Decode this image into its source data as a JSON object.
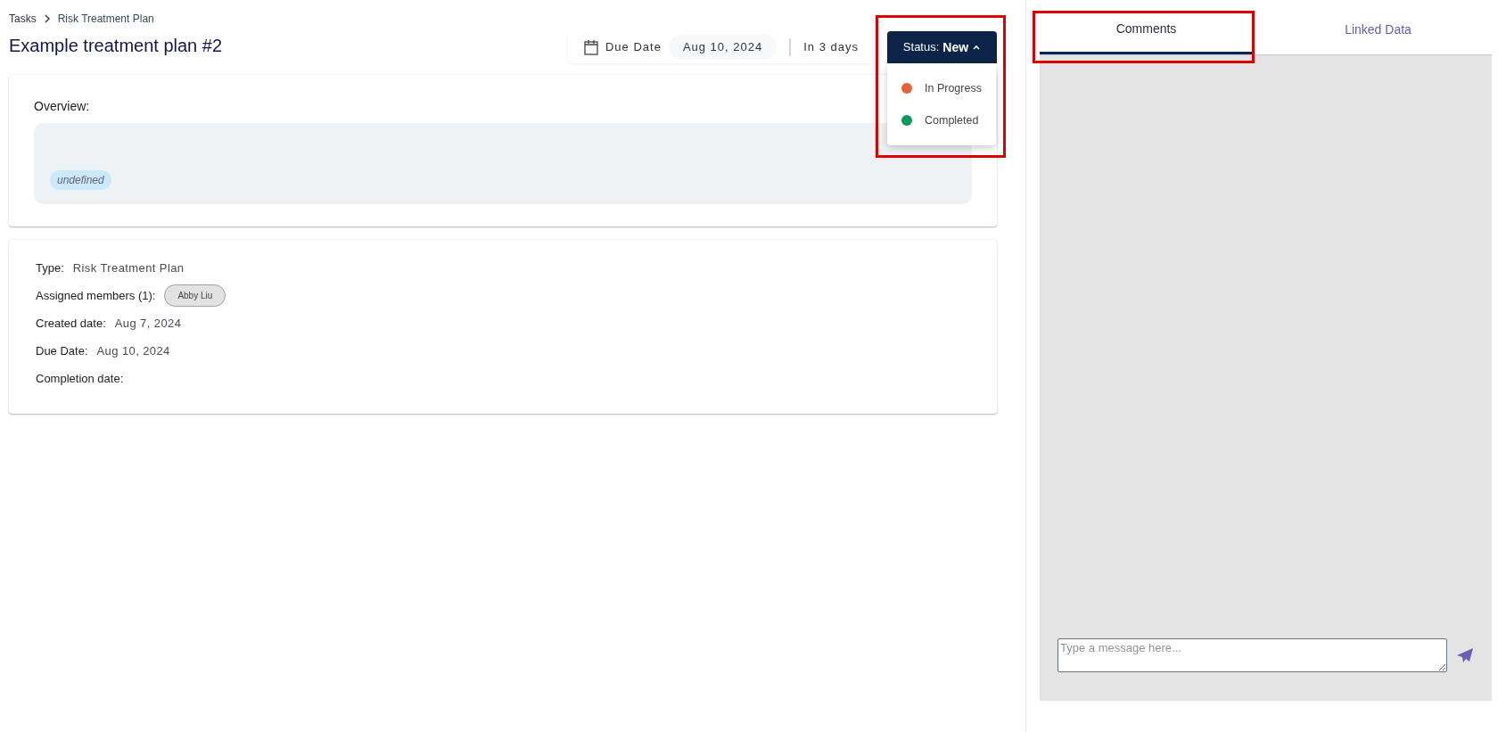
{
  "breadcrumbs": [
    {
      "label": "Tasks"
    },
    {
      "label": "Risk Treatment Plan"
    }
  ],
  "title": "Example treatment plan #2",
  "due": {
    "label": "Due Date",
    "date": "Aug 10, 2024",
    "relative": "In 3 days"
  },
  "status": {
    "label": "Status:",
    "value": "New",
    "expanded": true,
    "highlighted": true,
    "options": [
      {
        "label": "In Progress",
        "color": "#e8603c"
      },
      {
        "label": "Completed",
        "color": "#0a9a5c"
      }
    ]
  },
  "overview": {
    "label": "Overview:",
    "tags": [
      "undefined"
    ]
  },
  "details": [
    {
      "kind": "text",
      "label": "Type:",
      "value": "Risk Treatment Plan"
    },
    {
      "kind": "members",
      "label": "Assigned members (1):",
      "members": [
        "Abby Liu"
      ]
    },
    {
      "kind": "text",
      "label": "Created date:",
      "value": "Aug 7, 2024"
    },
    {
      "kind": "text",
      "label": "Due Date:",
      "value": "Aug 10, 2024"
    },
    {
      "kind": "text",
      "label": "Completion date:"
    }
  ],
  "tabs": [
    {
      "label": "Comments",
      "selected": true,
      "highlighted": true
    },
    {
      "label": "Linked Data",
      "selected": false,
      "highlighted": false
    }
  ],
  "composer": {
    "placeholder": "Type a message here..."
  }
}
